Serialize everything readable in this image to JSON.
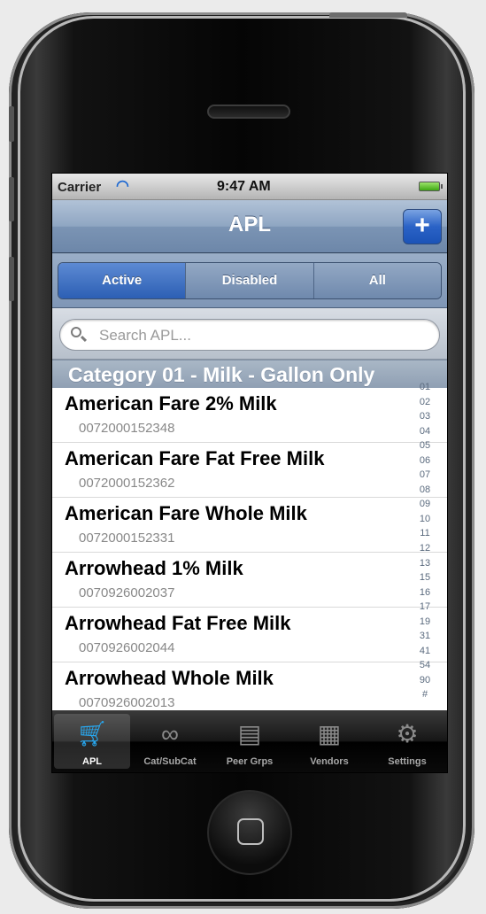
{
  "status": {
    "carrier": "Carrier",
    "wifi_icon": "wifi-icon",
    "time": "9:47 AM",
    "battery_icon": "battery-icon"
  },
  "nav": {
    "title": "APL",
    "add_label": "+"
  },
  "segments": [
    {
      "label": "Active",
      "selected": true
    },
    {
      "label": "Disabled",
      "selected": false
    },
    {
      "label": "All",
      "selected": false
    }
  ],
  "search": {
    "placeholder": "Search APL..."
  },
  "section": {
    "title": "Category 01 - Milk - Gallon Only"
  },
  "items": [
    {
      "name": "American Fare 2% Milk",
      "upc": "0072000152348"
    },
    {
      "name": "American Fare Fat Free Milk",
      "upc": "0072000152362"
    },
    {
      "name": "American Fare Whole Milk",
      "upc": "0072000152331"
    },
    {
      "name": "Arrowhead 1% Milk",
      "upc": "0070926002037"
    },
    {
      "name": "Arrowhead Fat Free Milk",
      "upc": "0070926002044"
    },
    {
      "name": "Arrowhead Whole Milk",
      "upc": "0070926002013"
    }
  ],
  "index": [
    "01",
    "02",
    "03",
    "04",
    "05",
    "06",
    "07",
    "08",
    "09",
    "10",
    "11",
    "12",
    "13",
    "15",
    "16",
    "17",
    "19",
    "31",
    "41",
    "54",
    "90",
    "#"
  ],
  "tabs": [
    {
      "label": "APL",
      "icon": "cart-icon",
      "selected": true
    },
    {
      "label": "Cat/SubCat",
      "icon": "link-icon",
      "selected": false
    },
    {
      "label": "Peer Grps",
      "icon": "tray-icon",
      "selected": false
    },
    {
      "label": "Vendors",
      "icon": "truck-icon",
      "selected": false
    },
    {
      "label": "Settings",
      "icon": "gears-icon",
      "selected": false
    }
  ],
  "colors": {
    "accent": "#2c5fb4",
    "tab_selected": "#27a9f2"
  }
}
